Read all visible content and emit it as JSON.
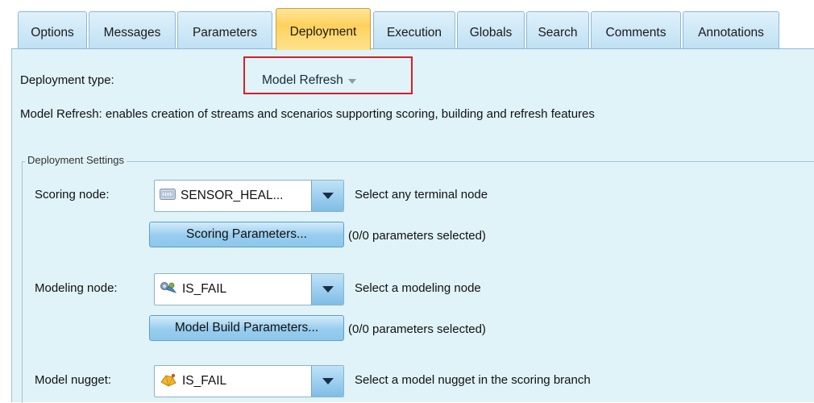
{
  "tabs": [
    {
      "label": "Options",
      "active": false
    },
    {
      "label": "Messages",
      "active": false
    },
    {
      "label": "Parameters",
      "active": false
    },
    {
      "label": "Deployment",
      "active": true
    },
    {
      "label": "Execution",
      "active": false
    },
    {
      "label": "Globals",
      "active": false
    },
    {
      "label": "Search",
      "active": false
    },
    {
      "label": "Comments",
      "active": false
    },
    {
      "label": "Annotations",
      "active": false
    }
  ],
  "deployment": {
    "type_label": "Deployment type:",
    "type_value": "Model Refresh",
    "description": "Model Refresh: enables creation of streams and scenarios supporting scoring, building and refresh features"
  },
  "settings": {
    "legend": "Deployment Settings",
    "scoring_node": {
      "label": "Scoring node:",
      "value": "SENSOR_HEAL...",
      "icon": "table-output-icon",
      "hint": "Select any terminal node",
      "params_button": "Scoring Parameters...",
      "params_status": "(0/0 parameters selected)"
    },
    "modeling_node": {
      "label": "Modeling node:",
      "value": "IS_FAIL",
      "icon": "modeling-node-icon",
      "hint": "Select a modeling node",
      "params_button": "Model Build Parameters...",
      "params_status": "(0/0 parameters selected)"
    },
    "model_nugget": {
      "label": "Model nugget:",
      "value": "IS_FAIL",
      "icon": "model-nugget-icon",
      "hint": "Select a model nugget in the scoring branch"
    }
  },
  "colors": {
    "panel_bg": "#dff3f8",
    "active_tab": "#ffd15c",
    "highlight_box": "#d3202a"
  }
}
